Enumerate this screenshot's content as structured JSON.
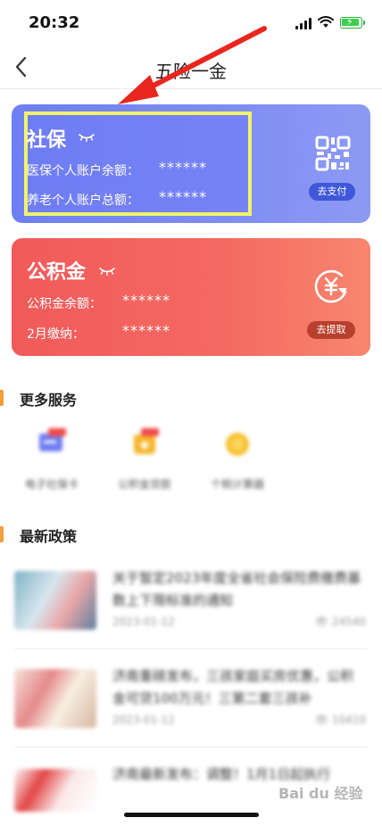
{
  "status": {
    "time": "20:32"
  },
  "nav": {
    "title": "五险一金"
  },
  "social_security": {
    "title": "社保",
    "medical_label": "医保个人账户余额：",
    "medical_value": "******",
    "pension_label": "养老个人账户总额：",
    "pension_value": "******",
    "pay_button": "去支付"
  },
  "housing_fund": {
    "title": "公积金",
    "balance_label": "公积金余额：",
    "balance_value": "******",
    "payment_label": "2月缴纳：",
    "payment_value": "******",
    "withdraw_button": "去提取"
  },
  "more_services": {
    "title": "更多服务",
    "items": [
      {
        "label": "电子社保卡",
        "icon": "card-icon"
      },
      {
        "label": "公积金贷款",
        "icon": "wallet-icon"
      },
      {
        "label": "个税计算器",
        "icon": "coin-icon"
      }
    ]
  },
  "policies": {
    "title": "最新政策",
    "items": [
      {
        "title": "关于暂定2023年度全省社会保险费缴费基数上下限标准的通知",
        "date": "2023-01-12",
        "views": "24540"
      },
      {
        "title": "济南重磅发布，三孩家庭买房优惠，公积金可贷100万元！三第二套三孩补",
        "date": "2023-01-12",
        "views": "10410"
      },
      {
        "title": "济南最新发布：调整！1月1日起执行",
        "date": "",
        "views": ""
      }
    ]
  },
  "watermark": "Bai du 经验",
  "colors": {
    "social_card": "#6d7ff4",
    "housing_card": "#f15a5a",
    "highlight_border": "#f1f46a",
    "annotation_arrow": "#e8261f",
    "section_accent": "#f39c38"
  }
}
